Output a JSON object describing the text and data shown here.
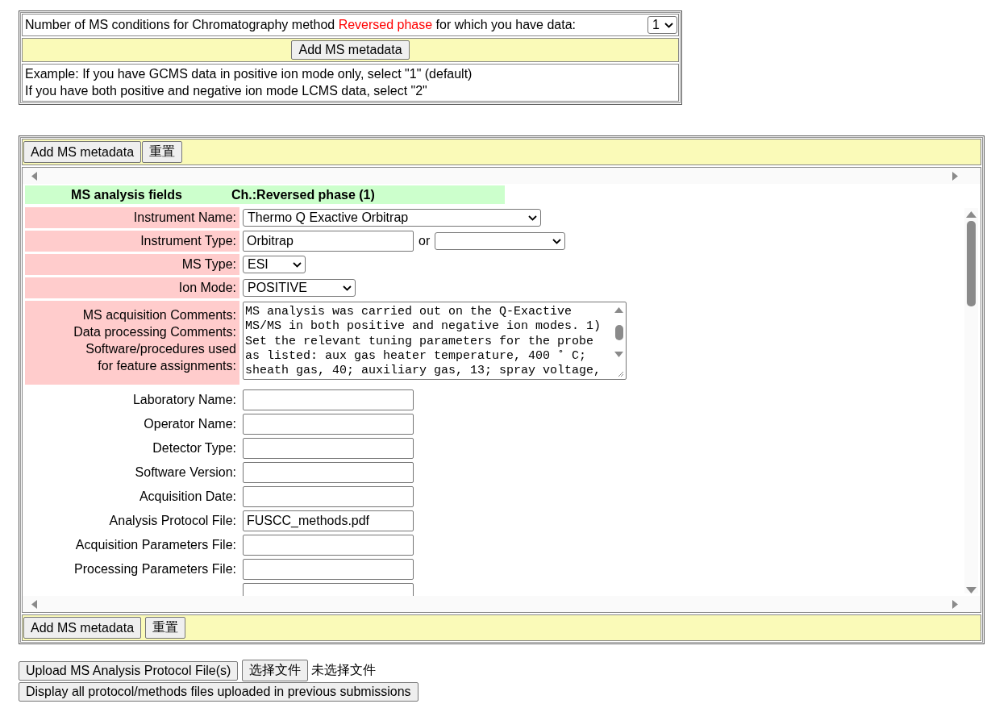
{
  "conditions": {
    "prompt_before": "Number of MS conditions for Chromatography method",
    "method": "Reversed phase",
    "prompt_after": "for which you have data:",
    "count": "1",
    "add_button": "Add MS metadata",
    "example_lines": [
      "Example: If you have GCMS data in positive ion mode only, select \"1\" (default)",
      "If you have both positive and negative ion mode LCMS data, select \"2\""
    ]
  },
  "form": {
    "top_buttons": [
      "Add MS metadata",
      "重置"
    ],
    "header": [
      "MS analysis fields",
      "Ch.:Reversed phase (1)"
    ],
    "fields": [
      {
        "kind": "select",
        "label": "Instrument Name:",
        "required": true,
        "value": "Thermo Q Exactive Orbitrap"
      },
      {
        "kind": "text_or_select",
        "label": "Instrument Type:",
        "required": true,
        "value": "Orbitrap",
        "or": "or"
      },
      {
        "kind": "select",
        "label": "MS Type:",
        "required": true,
        "value": "ESI"
      },
      {
        "kind": "select",
        "label": "Ion Mode:",
        "required": true,
        "value": "POSITIVE"
      },
      {
        "kind": "textarea",
        "label_lines": [
          "MS acquisition Comments:",
          "Data processing Comments:",
          "Software/procedures used",
          "for feature assignments:"
        ],
        "required": true,
        "value": "MS analysis was carried out on the Q-Exactive MS/MS in both positive and negative ion modes. 1) Set the relevant tuning parameters for the probe as listed: aux gas heater temperature, 400 ˚ C; sheath gas, 40; auxiliary gas, 13; spray voltage,"
      },
      {
        "kind": "text",
        "label": "Laboratory Name:",
        "required": false
      },
      {
        "kind": "text",
        "label": "Operator Name:",
        "required": false
      },
      {
        "kind": "text",
        "label": "Detector Type:",
        "required": false
      },
      {
        "kind": "text",
        "label": "Software Version:",
        "required": false
      },
      {
        "kind": "text",
        "label": "Acquisition Date:",
        "required": false
      },
      {
        "kind": "text",
        "label": "Analysis Protocol File:",
        "required": false,
        "value": "FUSCC_methods.pdf"
      },
      {
        "kind": "text",
        "label": "Acquisition Parameters File:",
        "required": false
      },
      {
        "kind": "text",
        "label": "Processing Parameters File:",
        "required": false
      },
      {
        "kind": "text"
      }
    ],
    "bottom_buttons": [
      "Add MS metadata",
      "重置"
    ]
  },
  "upload": {
    "upload_button": "Upload MS Analysis Protocol File(s)",
    "choose_button": "选择文件",
    "no_file": "未选择文件",
    "display_button": "Display all protocol/methods files uploaded in previous submissions"
  }
}
